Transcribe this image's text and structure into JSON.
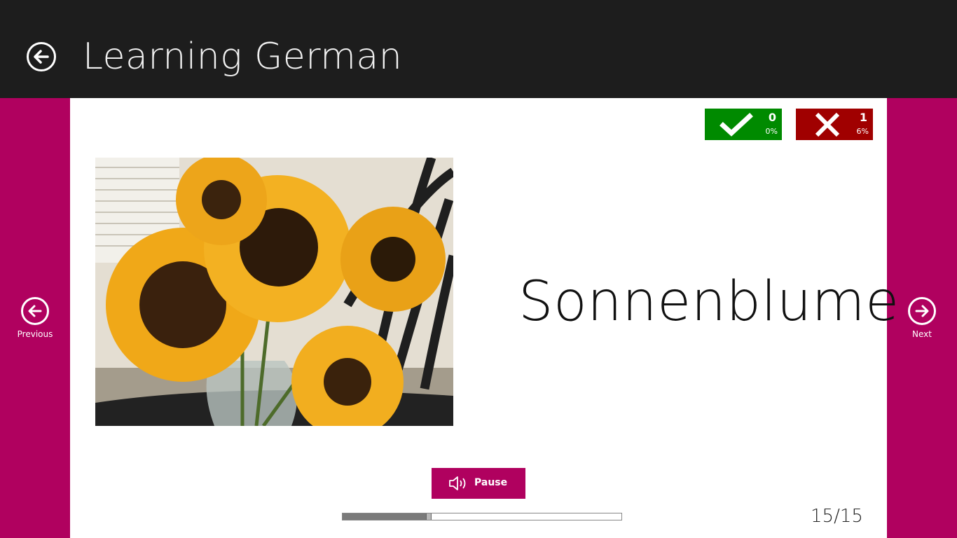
{
  "header": {
    "title": "Learning German",
    "back_icon": "back-arrow-icon"
  },
  "score": {
    "correct": {
      "icon": "checkmark-icon",
      "count": "0",
      "percent": "0%",
      "color": "#008a00"
    },
    "wrong": {
      "icon": "cross-icon",
      "count": "1",
      "percent": "6%",
      "color": "#a00000"
    }
  },
  "flashcard": {
    "word": "Sonnenblume",
    "image_subject": "sunflowers in a glass vase"
  },
  "audio": {
    "button_label": "Pause",
    "icon": "speaker-icon"
  },
  "progress": {
    "fraction": 0.32,
    "counter": "15/15"
  },
  "navigation": {
    "previous_label": "Previous",
    "previous_icon": "arrow-left-icon",
    "next_label": "Next",
    "next_icon": "arrow-right-icon"
  },
  "colors": {
    "accent": "#b0015f",
    "header_bg": "#1d1d1d",
    "card_bg": "#ffffff"
  }
}
